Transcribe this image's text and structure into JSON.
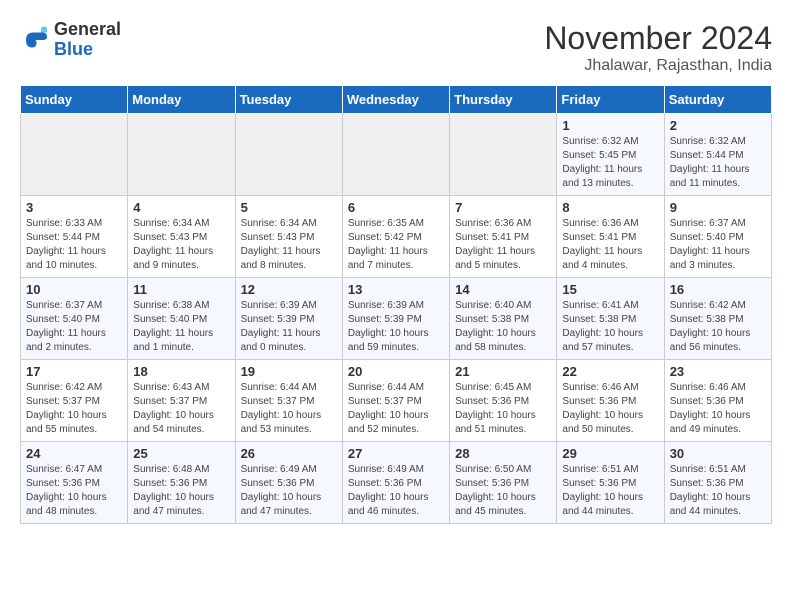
{
  "logo": {
    "general": "General",
    "blue": "Blue"
  },
  "title": "November 2024",
  "subtitle": "Jhalawar, Rajasthan, India",
  "days_of_week": [
    "Sunday",
    "Monday",
    "Tuesday",
    "Wednesday",
    "Thursday",
    "Friday",
    "Saturday"
  ],
  "weeks": [
    [
      {
        "day": "",
        "info": ""
      },
      {
        "day": "",
        "info": ""
      },
      {
        "day": "",
        "info": ""
      },
      {
        "day": "",
        "info": ""
      },
      {
        "day": "",
        "info": ""
      },
      {
        "day": "1",
        "info": "Sunrise: 6:32 AM\nSunset: 5:45 PM\nDaylight: 11 hours and 13 minutes."
      },
      {
        "day": "2",
        "info": "Sunrise: 6:32 AM\nSunset: 5:44 PM\nDaylight: 11 hours and 11 minutes."
      }
    ],
    [
      {
        "day": "3",
        "info": "Sunrise: 6:33 AM\nSunset: 5:44 PM\nDaylight: 11 hours and 10 minutes."
      },
      {
        "day": "4",
        "info": "Sunrise: 6:34 AM\nSunset: 5:43 PM\nDaylight: 11 hours and 9 minutes."
      },
      {
        "day": "5",
        "info": "Sunrise: 6:34 AM\nSunset: 5:43 PM\nDaylight: 11 hours and 8 minutes."
      },
      {
        "day": "6",
        "info": "Sunrise: 6:35 AM\nSunset: 5:42 PM\nDaylight: 11 hours and 7 minutes."
      },
      {
        "day": "7",
        "info": "Sunrise: 6:36 AM\nSunset: 5:41 PM\nDaylight: 11 hours and 5 minutes."
      },
      {
        "day": "8",
        "info": "Sunrise: 6:36 AM\nSunset: 5:41 PM\nDaylight: 11 hours and 4 minutes."
      },
      {
        "day": "9",
        "info": "Sunrise: 6:37 AM\nSunset: 5:40 PM\nDaylight: 11 hours and 3 minutes."
      }
    ],
    [
      {
        "day": "10",
        "info": "Sunrise: 6:37 AM\nSunset: 5:40 PM\nDaylight: 11 hours and 2 minutes."
      },
      {
        "day": "11",
        "info": "Sunrise: 6:38 AM\nSunset: 5:40 PM\nDaylight: 11 hours and 1 minute."
      },
      {
        "day": "12",
        "info": "Sunrise: 6:39 AM\nSunset: 5:39 PM\nDaylight: 11 hours and 0 minutes."
      },
      {
        "day": "13",
        "info": "Sunrise: 6:39 AM\nSunset: 5:39 PM\nDaylight: 10 hours and 59 minutes."
      },
      {
        "day": "14",
        "info": "Sunrise: 6:40 AM\nSunset: 5:38 PM\nDaylight: 10 hours and 58 minutes."
      },
      {
        "day": "15",
        "info": "Sunrise: 6:41 AM\nSunset: 5:38 PM\nDaylight: 10 hours and 57 minutes."
      },
      {
        "day": "16",
        "info": "Sunrise: 6:42 AM\nSunset: 5:38 PM\nDaylight: 10 hours and 56 minutes."
      }
    ],
    [
      {
        "day": "17",
        "info": "Sunrise: 6:42 AM\nSunset: 5:37 PM\nDaylight: 10 hours and 55 minutes."
      },
      {
        "day": "18",
        "info": "Sunrise: 6:43 AM\nSunset: 5:37 PM\nDaylight: 10 hours and 54 minutes."
      },
      {
        "day": "19",
        "info": "Sunrise: 6:44 AM\nSunset: 5:37 PM\nDaylight: 10 hours and 53 minutes."
      },
      {
        "day": "20",
        "info": "Sunrise: 6:44 AM\nSunset: 5:37 PM\nDaylight: 10 hours and 52 minutes."
      },
      {
        "day": "21",
        "info": "Sunrise: 6:45 AM\nSunset: 5:36 PM\nDaylight: 10 hours and 51 minutes."
      },
      {
        "day": "22",
        "info": "Sunrise: 6:46 AM\nSunset: 5:36 PM\nDaylight: 10 hours and 50 minutes."
      },
      {
        "day": "23",
        "info": "Sunrise: 6:46 AM\nSunset: 5:36 PM\nDaylight: 10 hours and 49 minutes."
      }
    ],
    [
      {
        "day": "24",
        "info": "Sunrise: 6:47 AM\nSunset: 5:36 PM\nDaylight: 10 hours and 48 minutes."
      },
      {
        "day": "25",
        "info": "Sunrise: 6:48 AM\nSunset: 5:36 PM\nDaylight: 10 hours and 47 minutes."
      },
      {
        "day": "26",
        "info": "Sunrise: 6:49 AM\nSunset: 5:36 PM\nDaylight: 10 hours and 47 minutes."
      },
      {
        "day": "27",
        "info": "Sunrise: 6:49 AM\nSunset: 5:36 PM\nDaylight: 10 hours and 46 minutes."
      },
      {
        "day": "28",
        "info": "Sunrise: 6:50 AM\nSunset: 5:36 PM\nDaylight: 10 hours and 45 minutes."
      },
      {
        "day": "29",
        "info": "Sunrise: 6:51 AM\nSunset: 5:36 PM\nDaylight: 10 hours and 44 minutes."
      },
      {
        "day": "30",
        "info": "Sunrise: 6:51 AM\nSunset: 5:36 PM\nDaylight: 10 hours and 44 minutes."
      }
    ]
  ]
}
